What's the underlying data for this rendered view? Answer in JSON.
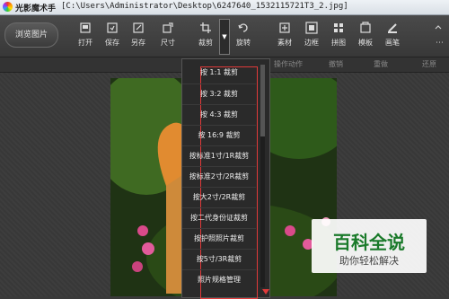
{
  "window": {
    "app_name": "光影魔术手",
    "path": "[C:\\Users\\Administrator\\Desktop\\6247640_1532115721T3_2.jpg]"
  },
  "toolbar": {
    "browse_label": "浏览图片",
    "buttons": [
      {
        "label": "打开",
        "icon": "open-icon"
      },
      {
        "label": "保存",
        "icon": "save-icon"
      },
      {
        "label": "另存",
        "icon": "save-as-icon"
      },
      {
        "label": "尺寸",
        "icon": "resize-icon"
      },
      {
        "label": "裁剪",
        "icon": "crop-icon"
      },
      {
        "label": "旋转",
        "icon": "rotate-icon"
      },
      {
        "label": "素材",
        "icon": "material-icon"
      },
      {
        "label": "边框",
        "icon": "frame-icon"
      },
      {
        "label": "拼图",
        "icon": "collage-icon"
      },
      {
        "label": "模板",
        "icon": "template-icon"
      },
      {
        "label": "画笔",
        "icon": "brush-icon"
      }
    ]
  },
  "subbar": {
    "history": "操作动作",
    "undo": "撤销",
    "redo": "重做",
    "revert": "还原"
  },
  "crop_menu": {
    "items": [
      "按 1:1 裁剪",
      "按 3:2 裁剪",
      "按 4:3 裁剪",
      "按 16:9 裁剪",
      "按标准1寸/1R裁剪",
      "按标准2寸/2R裁剪",
      "按大2寸/2R裁剪",
      "按二代身份证裁剪",
      "按护照照片裁剪",
      "按5寸/3R裁剪",
      "照片规格管理"
    ]
  },
  "watermark": {
    "title": "百科全说",
    "subtitle": "助你轻松解决"
  }
}
